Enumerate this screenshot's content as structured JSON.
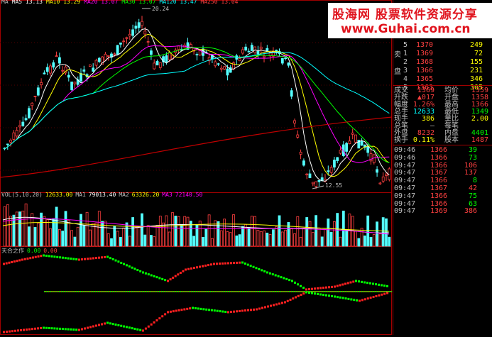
{
  "legends": {
    "ma": [
      {
        "text": "MA",
        "color": "#c0c0c0"
      },
      {
        "text": "MA5 13.13",
        "color": "#ffffff"
      },
      {
        "text": "MA10 13.29",
        "color": "#ffff00"
      },
      {
        "text": "MA20 13.07",
        "color": "#ff00ff"
      },
      {
        "text": "MA30 13.07",
        "color": "#00ff00"
      },
      {
        "text": "MA120 13.47",
        "color": "#00ffff"
      },
      {
        "text": "MA250 13.04",
        "color": "#ff4040"
      }
    ],
    "vol": [
      {
        "text": "VOL(5,10,20)",
        "color": "#c0c0c0"
      },
      {
        "text": "12633.00",
        "color": "#ffff00"
      },
      {
        "text": "MA1",
        "color": "#c0c0c0"
      },
      {
        "text": "79013.40",
        "color": "#ffffff"
      },
      {
        "text": "MA2",
        "color": "#c0c0c0"
      },
      {
        "text": "63326.20",
        "color": "#ffff00"
      },
      {
        "text": "MA3",
        "color": "#ff00ff"
      },
      {
        "text": "72140.50",
        "color": "#ff00ff"
      }
    ],
    "indicator": [
      {
        "text": "天合之作",
        "color": "#c0c0c0"
      },
      {
        "text": "0.00",
        "color": "#00ff00"
      },
      {
        "text": "0.00",
        "color": "#ff4040"
      }
    ]
  },
  "price_labels": {
    "high": "20.24",
    "low": "12.55"
  },
  "watermark": {
    "line1": "股海网 股票软件资源分享",
    "line2": "www.Guhai.com.cn"
  },
  "orderbook": {
    "sell_label": "卖",
    "buy_label": "盘",
    "rows": [
      {
        "n": "5",
        "price": "1370",
        "vol": "249"
      },
      {
        "n": "1",
        "price": "1369",
        "vol": "72"
      },
      {
        "n": "2",
        "price": "1368",
        "vol": "155"
      },
      {
        "n": "3",
        "price": "1366",
        "vol": "231"
      },
      {
        "n": "4",
        "price": "1365",
        "vol": "346"
      },
      {
        "n": "5",
        "price": "1363",
        "vol": "305"
      }
    ]
  },
  "quote": [
    {
      "l1": "成交",
      "v1": "1369",
      "l2": "均价",
      "v2": "1359",
      "c1": "#ff4040",
      "c2": "#ff4040"
    },
    {
      "l1": "升跌",
      "v1": "▲017",
      "l2": "开盘",
      "v2": "1358",
      "c1": "#ff4040",
      "c2": "#ff4040"
    },
    {
      "l1": "幅度",
      "v1": "1.26%",
      "l2": "最高",
      "v2": "1366",
      "c1": "#ff4040",
      "c2": "#ff4040"
    },
    {
      "l1": "总手",
      "v1": "12633",
      "l2": "最低",
      "v2": "1349",
      "c1": "#00ffff",
      "c2": "#00ff00"
    },
    {
      "l1": "现手",
      "v1": "386",
      "l2": "量比",
      "v2": "2.00",
      "c1": "#ffff00",
      "c2": "#ffff00"
    },
    {
      "l1": "总笔",
      "v1": "—",
      "l2": "每笔",
      "v2": "",
      "c1": "#c0c0c0",
      "c2": "#c0c0c0"
    },
    {
      "l1": "外盘",
      "v1": "8232",
      "l2": "内盘",
      "v2": "4401",
      "c1": "#ff4040",
      "c2": "#00ff00"
    },
    {
      "l1": "换手",
      "v1": "0.11%",
      "l2": "股本",
      "v2": "1487",
      "c1": "#ffff00",
      "c2": "#ff4040"
    }
  ],
  "trades": [
    {
      "time": "09:46",
      "price": "1366",
      "vol": "39",
      "pc": "#ff4040",
      "vc": "#00ff00"
    },
    {
      "time": "09:46",
      "price": "1366",
      "vol": "73",
      "pc": "#ff4040",
      "vc": "#00ff00"
    },
    {
      "time": "09:47",
      "price": "1366",
      "vol": "106",
      "pc": "#ff4040",
      "vc": "#ff4040"
    },
    {
      "time": "09:47",
      "price": "1367",
      "vol": "137",
      "pc": "#ff4040",
      "vc": "#ff4040"
    },
    {
      "time": "09:47",
      "price": "1366",
      "vol": "8",
      "pc": "#ff4040",
      "vc": "#00ff00"
    },
    {
      "time": "09:47",
      "price": "1367",
      "vol": "42",
      "pc": "#ff4040",
      "vc": "#ff4040"
    },
    {
      "time": "09:47",
      "price": "1366",
      "vol": "75",
      "pc": "#ff4040",
      "vc": "#00ff00"
    },
    {
      "time": "09:47",
      "price": "1366",
      "vol": "63",
      "pc": "#ff4040",
      "vc": "#00ff00"
    },
    {
      "time": "09:47",
      "price": "1369",
      "vol": "386",
      "pc": "#ff4040",
      "vc": "#ff4040"
    }
  ]
}
